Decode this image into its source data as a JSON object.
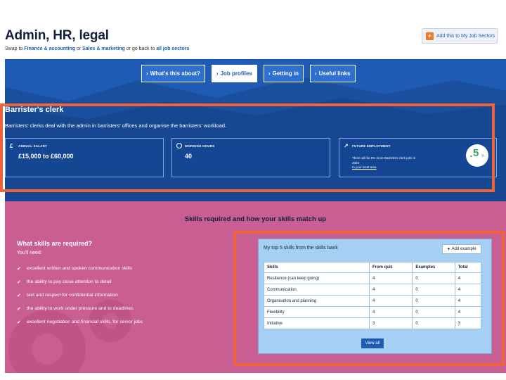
{
  "header": {
    "title": "Admin, HR, legal",
    "swap": {
      "prefix": "Swap to",
      "link1": "Finance & accounting",
      "or1": "or",
      "link2": "Sales & marketing",
      "or2": "or go back to",
      "link3": "all job sectors"
    },
    "add_button_label": "Add this to My Job Sectors",
    "add_button_icon": "plus-icon"
  },
  "tabs": [
    {
      "label": "What's this about?",
      "active": false
    },
    {
      "label": "Job profiles",
      "active": true
    },
    {
      "label": "Getting in",
      "active": false
    },
    {
      "label": "Useful links",
      "active": false
    }
  ],
  "profile": {
    "title": "Barrister's clerk",
    "description": "Barristers' clerks deal with the admin in barristers' offices and organise the barristers' workload.",
    "salary_label": "Annual salary",
    "salary_value": "£15,000 to £60,000",
    "salary_icon": "£",
    "hours_label": "Working hours",
    "hours_value": "40",
    "future_label": "Future employment",
    "future_text": "There will be 5% more Barristers clerk jobs in 2022",
    "future_link": "In your local area",
    "future_pct": "5",
    "future_pct_sign": "%",
    "future_pct_arrow": "▲"
  },
  "skills": {
    "heading": "Skills required and how your skills match up",
    "required_title": "What skills are required?",
    "need_label": "You'll need:",
    "items": [
      "excellent written and spoken communication skills",
      "the ability to pay close attention to detail",
      "tact and respect for confidential information",
      "the ability to work under pressure and to deadlines",
      "excellent negotiation and financial skills, for senior jobs"
    ],
    "top5": {
      "title": "My top 5 skills from the skills bank",
      "add_example_label": "Add example",
      "columns": [
        "Skills",
        "From quiz",
        "Examples",
        "Total"
      ],
      "rows": [
        [
          "Resilience (can keep going)",
          "4",
          "0",
          "4"
        ],
        [
          "Communication",
          "4",
          "0",
          "4"
        ],
        [
          "Organisation and planning",
          "4",
          "0",
          "4"
        ],
        [
          "Flexibility",
          "4",
          "0",
          "4"
        ],
        [
          "Initiative",
          "3",
          "0",
          "3"
        ]
      ],
      "view_all_label": "View all"
    }
  },
  "colors": {
    "hero_blue": "#1f5bb5",
    "skills_pink": "#c85e92",
    "highlight_orange": "#f0623a",
    "panel_blue": "#a6d0f3"
  }
}
